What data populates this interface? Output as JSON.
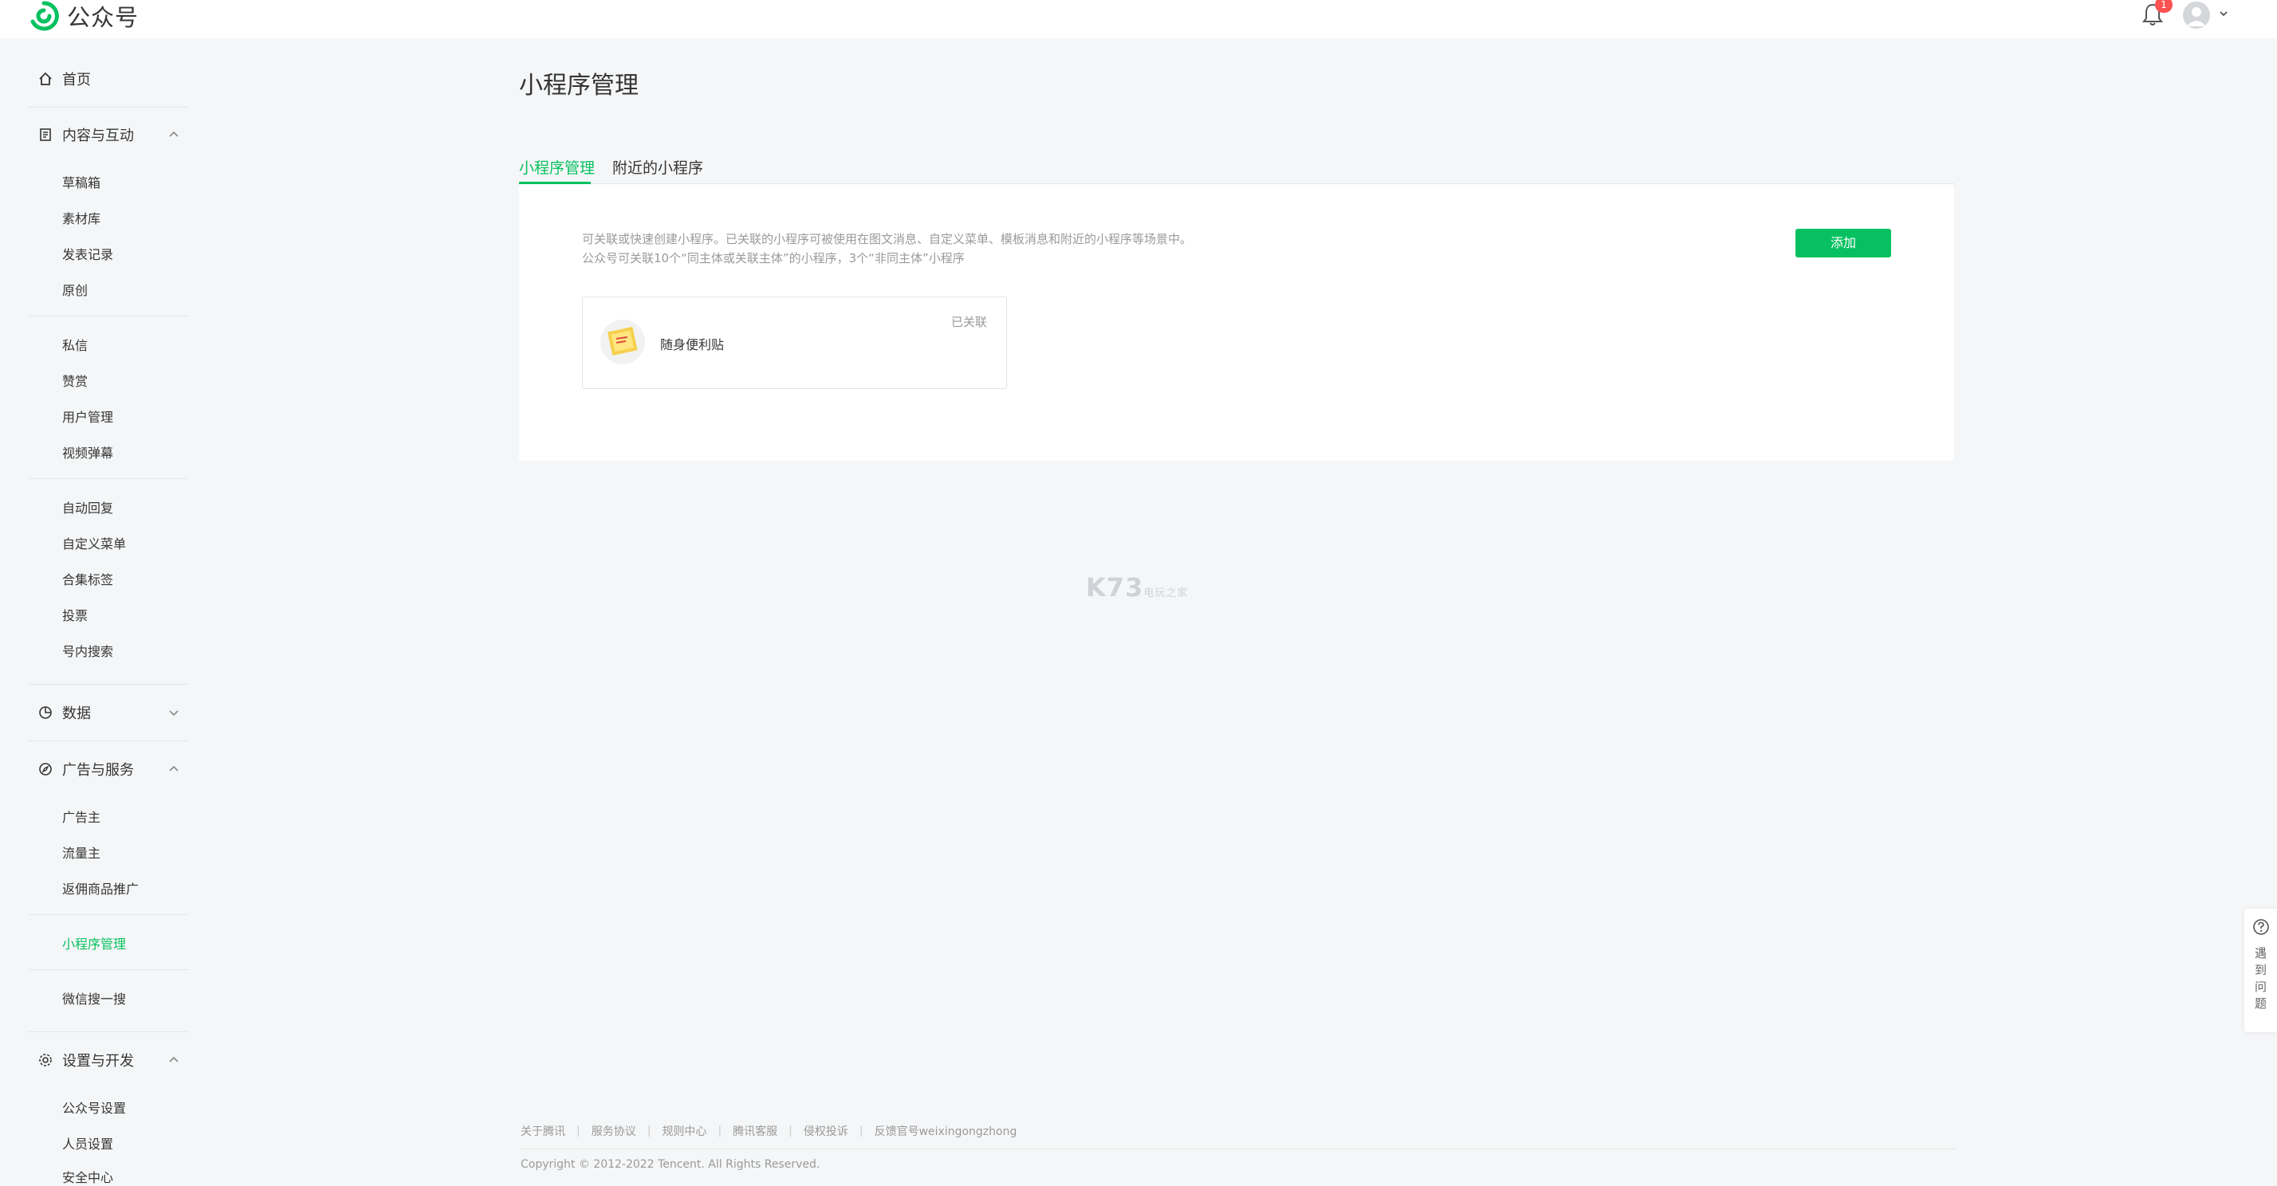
{
  "brand": {
    "name": "公众号",
    "accent": "#07c160"
  },
  "header": {
    "notification_count": "1"
  },
  "sidebar": {
    "home": "首页",
    "content": {
      "label": "内容与互动",
      "items": [
        "草稿箱",
        "素材库",
        "发表记录",
        "原创",
        "私信",
        "赞赏",
        "用户管理",
        "视频弹幕",
        "自动回复",
        "自定义菜单",
        "合集标签",
        "投票",
        "号内搜索"
      ]
    },
    "data": {
      "label": "数据"
    },
    "ads": {
      "label": "广告与服务",
      "items": [
        "广告主",
        "流量主",
        "返佣商品推广",
        "小程序管理",
        "微信搜一搜"
      ]
    },
    "settings": {
      "label": "设置与开发",
      "items": [
        "公众号设置",
        "人员设置",
        "安全中心"
      ]
    }
  },
  "main": {
    "title": "小程序管理",
    "tabs": [
      "小程序管理",
      "附近的小程序"
    ],
    "desc_line1": "可关联或快速创建小程序。已关联的小程序可被使用在图文消息、自定义菜单、模板消息和附近的小程序等场景中。",
    "desc_line2": "公众号可关联10个“同主体或关联主体”的小程序，3个“非同主体”小程序",
    "add_label": "添加",
    "mini_program": {
      "name": "随身便利贴",
      "status": "已关联"
    }
  },
  "watermark": {
    "main": "K73",
    "sub": "电玩之家"
  },
  "help": {
    "label": "遇到问题",
    "chars": [
      "遇",
      "到",
      "问",
      "题"
    ]
  },
  "footer": {
    "links": [
      "关于腾讯",
      "服务协议",
      "规则中心",
      "腾讯客服",
      "侵权投诉",
      "反馈官号weixingongzhong"
    ],
    "copyright": "Copyright © 2012-2022 Tencent. All Rights Reserved."
  }
}
